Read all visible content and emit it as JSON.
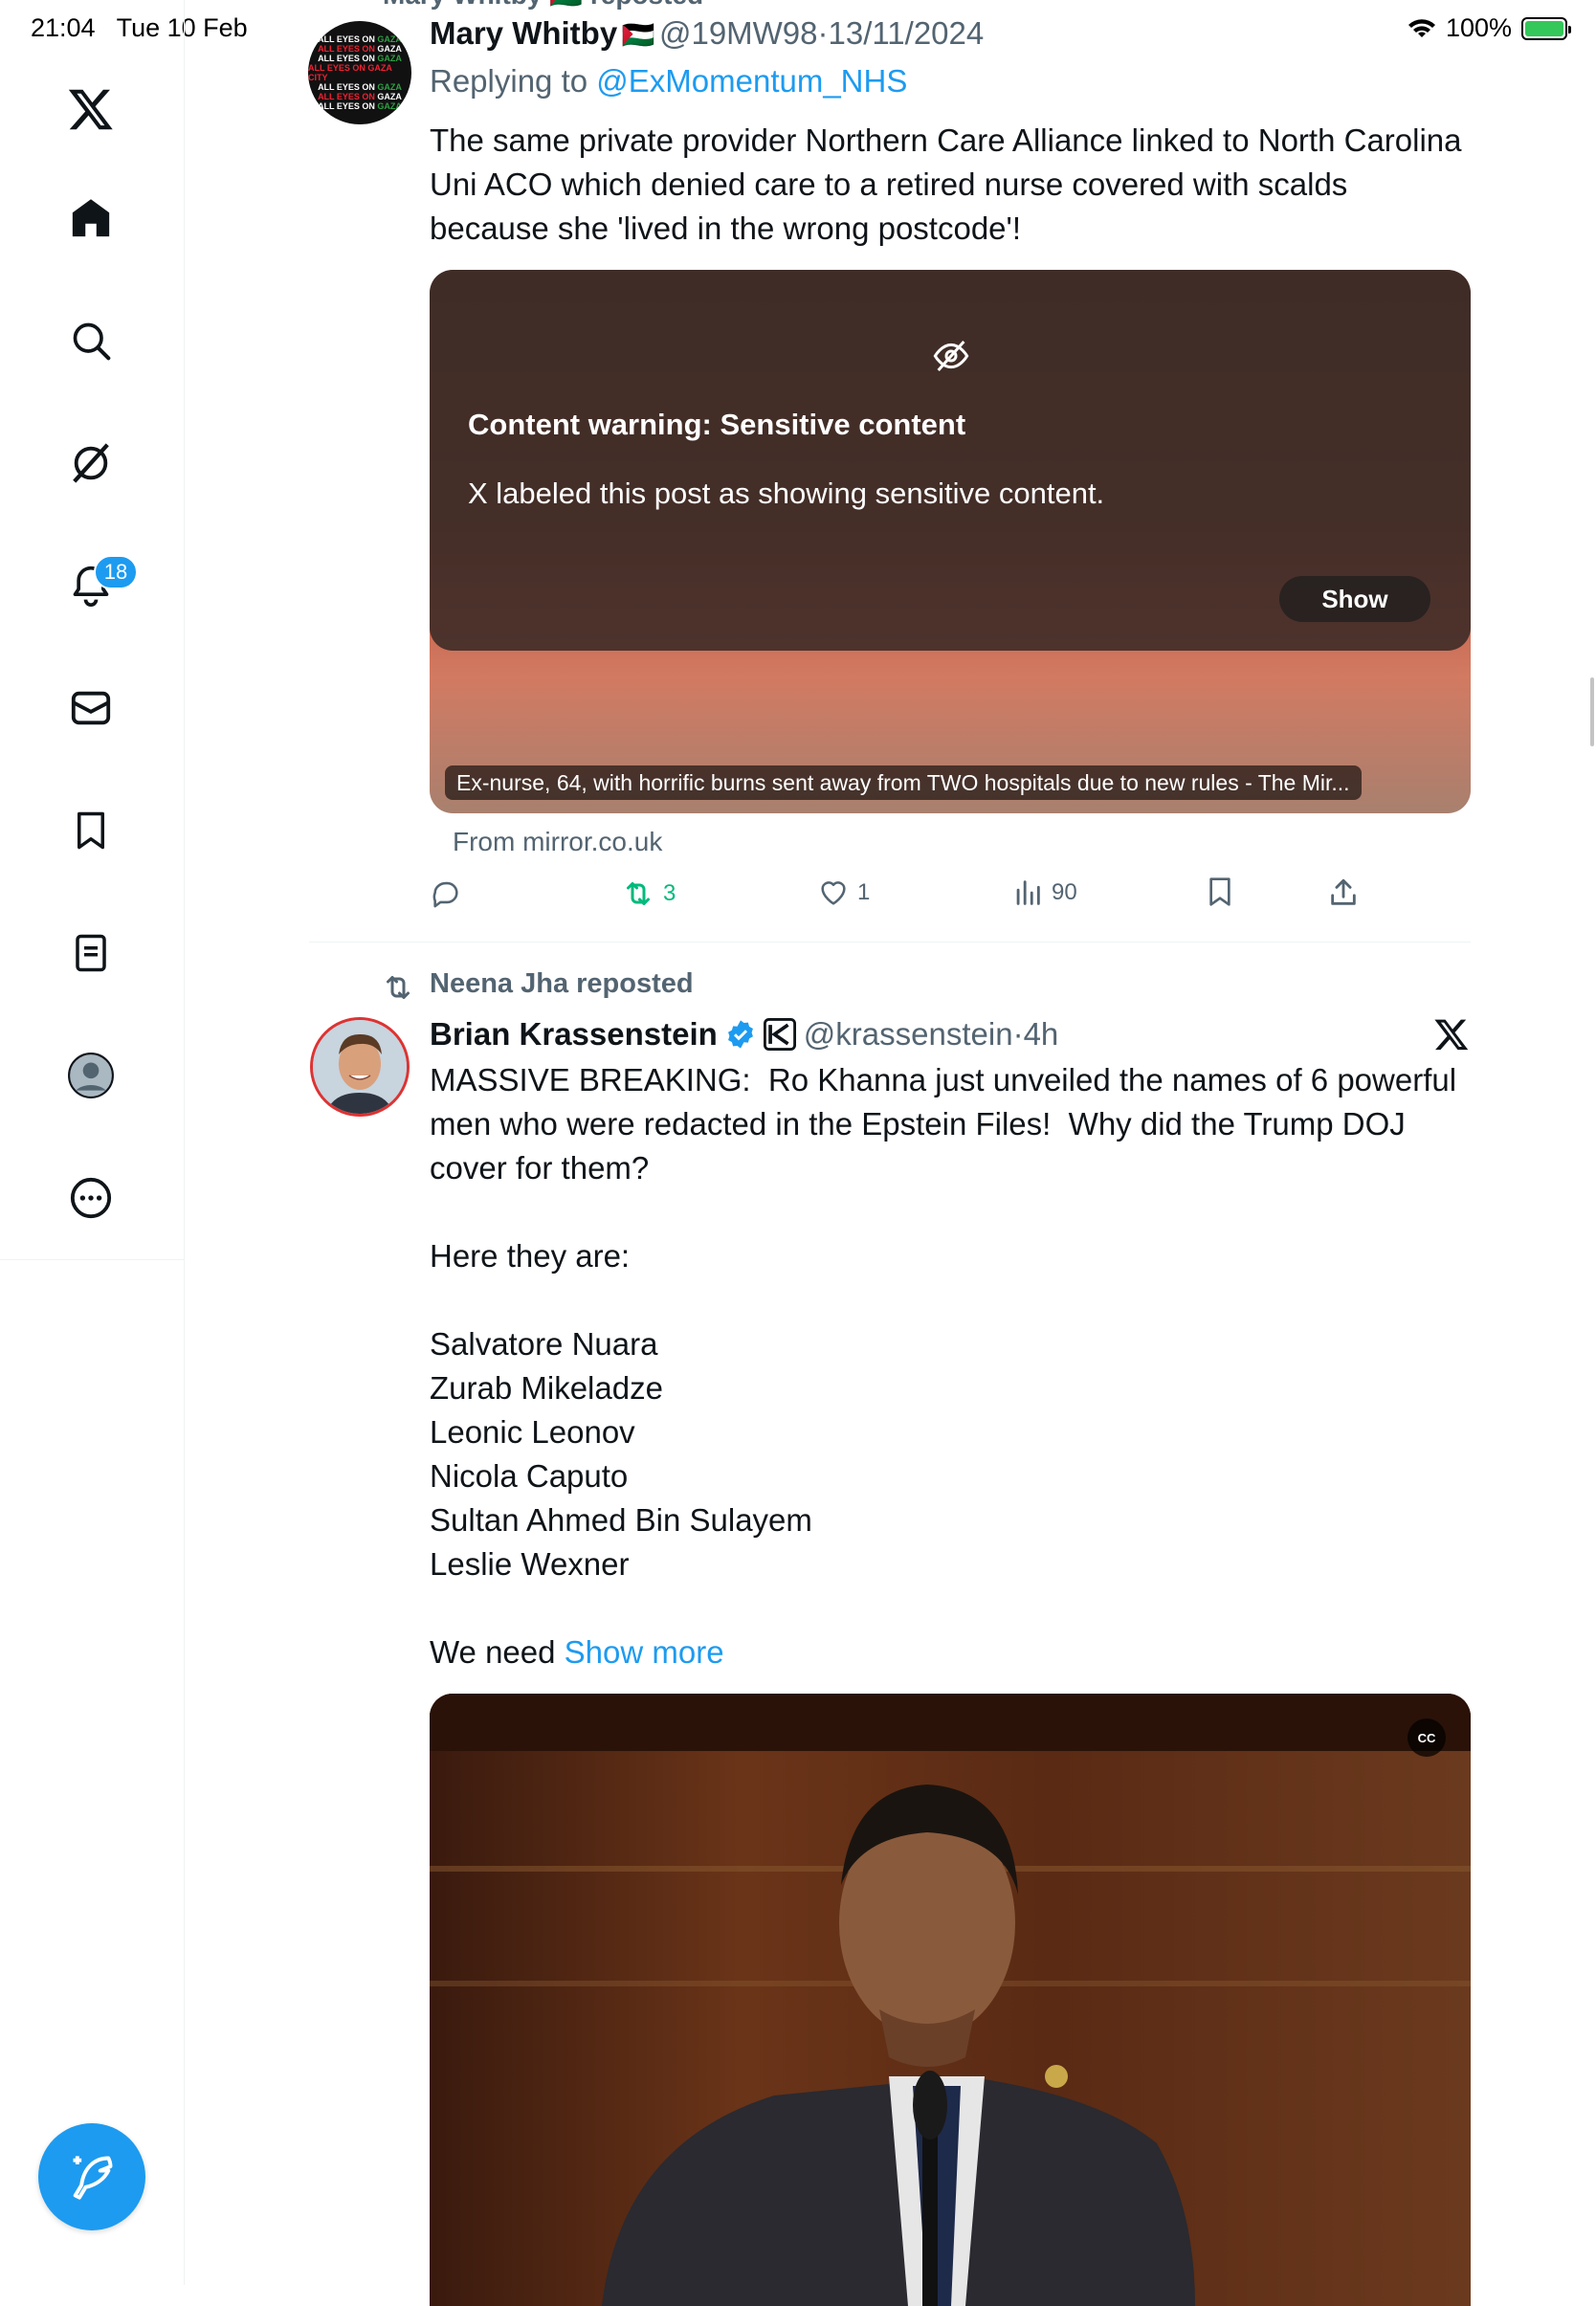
{
  "status_bar": {
    "time": "21:04",
    "date": "Tue 10 Feb",
    "battery": "100%"
  },
  "sidebar": {
    "items": [
      {
        "icon": "x-logo-icon"
      },
      {
        "icon": "home-icon"
      },
      {
        "icon": "search-icon"
      },
      {
        "icon": "grok-icon"
      },
      {
        "icon": "notifications-icon",
        "badge": "18"
      },
      {
        "icon": "messages-icon"
      },
      {
        "icon": "bookmarks-icon"
      },
      {
        "icon": "lists-icon"
      },
      {
        "icon": "profile-icon"
      },
      {
        "icon": "more-icon"
      }
    ],
    "compose_icon": "compose-icon"
  },
  "tweet1": {
    "repost_context": "Mary Whitby 🇵🇸 reposted",
    "author_name": "Mary Whitby",
    "author_flag": "🇵🇸",
    "handle": "@19MW98",
    "dot": "·",
    "date": "13/11/2024",
    "replying_to_label": "Replying to ",
    "replying_to_handle": "@ExMomentum_NHS",
    "text": "The same private provider Northern Care Alliance linked to North Carolina Uni ACO which denied care to a retired nurse covered with scalds because she 'lived in the wrong postcode'!",
    "warning_title": "Content warning: Sensitive content",
    "warning_text": "X labeled this post as showing sensitive content.",
    "show_label": "Show",
    "link_title": "Ex-nurse, 64, with horrific burns sent away from TWO hospitals due to new rules - The Mir...",
    "link_source": "From mirror.co.uk",
    "reposts": "3",
    "likes": "1",
    "views": "90",
    "avatar_text": "ALL EYES ON GAZA CITY"
  },
  "tweet2": {
    "repost_context": "Neena Jha reposted",
    "author_name": "Brian Krassenstein",
    "handle": "@krassenstein",
    "dot": "·",
    "time": "4h",
    "text": "MASSIVE BREAKING:  Ro Khanna just unveiled the names of 6 powerful men who were redacted in the Epstein Files!  Why did the Trump DOJ cover for them?\n\nHere they are:\n\nSalvatore Nuara\nZurab Mikeladze\nLeonic Leonov\nNicola Caputo\nSultan Ahmed Bin Sulayem\nLeslie Wexner\n\nWe need ",
    "show_more": "Show more",
    "cc_label": "CC"
  },
  "colors": {
    "accent": "#1d9bf0",
    "repost_green": "#00ba7c",
    "muted": "#536471"
  }
}
